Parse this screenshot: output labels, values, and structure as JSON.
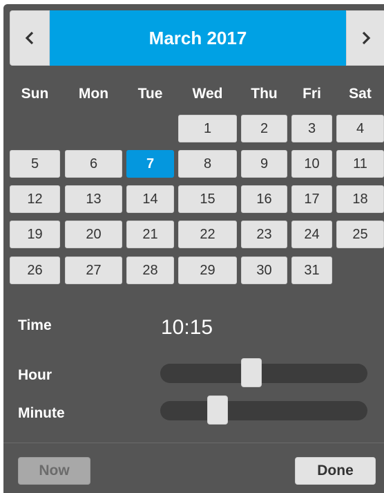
{
  "header": {
    "title": "March 2017",
    "prev_icon": "chevron-left-icon",
    "next_icon": "chevron-right-icon",
    "accent_color": "#00a1e4"
  },
  "daynames": [
    "Sun",
    "Mon",
    "Tue",
    "Wed",
    "Thu",
    "Fri",
    "Sat"
  ],
  "calendar": {
    "selected_day": "7",
    "weeks": [
      [
        "",
        "",
        "",
        "1",
        "2",
        "3",
        "4"
      ],
      [
        "5",
        "6",
        "7",
        "8",
        "9",
        "10",
        "11"
      ],
      [
        "12",
        "13",
        "14",
        "15",
        "16",
        "17",
        "18"
      ],
      [
        "19",
        "20",
        "21",
        "22",
        "23",
        "24",
        "25"
      ],
      [
        "26",
        "27",
        "28",
        "29",
        "30",
        "31",
        ""
      ]
    ]
  },
  "time": {
    "label": "Time",
    "value": "10:15",
    "hour_label": "Hour",
    "minute_label": "Minute",
    "hour_fraction": 0.435,
    "minute_fraction": 0.25
  },
  "buttons": {
    "now": "Now",
    "done": "Done"
  }
}
